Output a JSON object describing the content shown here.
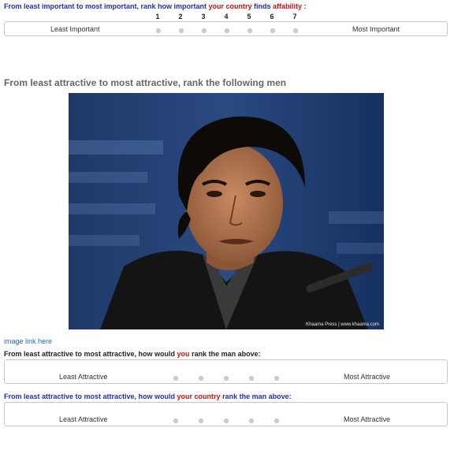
{
  "q1": {
    "parts": [
      "From least important to most important, rank how important ",
      "your country",
      " finds ",
      "affability",
      " :"
    ],
    "scale": [
      "1",
      "2",
      "3",
      "4",
      "5",
      "6",
      "7"
    ],
    "left_label": "Least Important",
    "right_label": "Most Important"
  },
  "section": {
    "heading": "From least attractive to most attractive, rank the following men",
    "image_caption": "Khaama Press | www.khaama.com",
    "image_link": "image link here"
  },
  "q2": {
    "parts": [
      "From least attractive to most attractive, how would ",
      "you",
      " rank the man above:"
    ],
    "scale": [
      "1",
      "2",
      "3",
      "4",
      "5"
    ],
    "left_label": "Least Attractive",
    "right_label": "Most Attractive"
  },
  "q3": {
    "parts": [
      "From least attractive to most attractive, how would ",
      "your country",
      " rank the man above:"
    ],
    "scale": [
      "1",
      "2",
      "3",
      "4",
      "5"
    ],
    "left_label": "Least Attractive",
    "right_label": "Most Attractive"
  },
  "colors": {
    "question_blue": "#1b2fc1",
    "emphasis_red": "#d01010",
    "link_blue": "#2a68c9"
  }
}
